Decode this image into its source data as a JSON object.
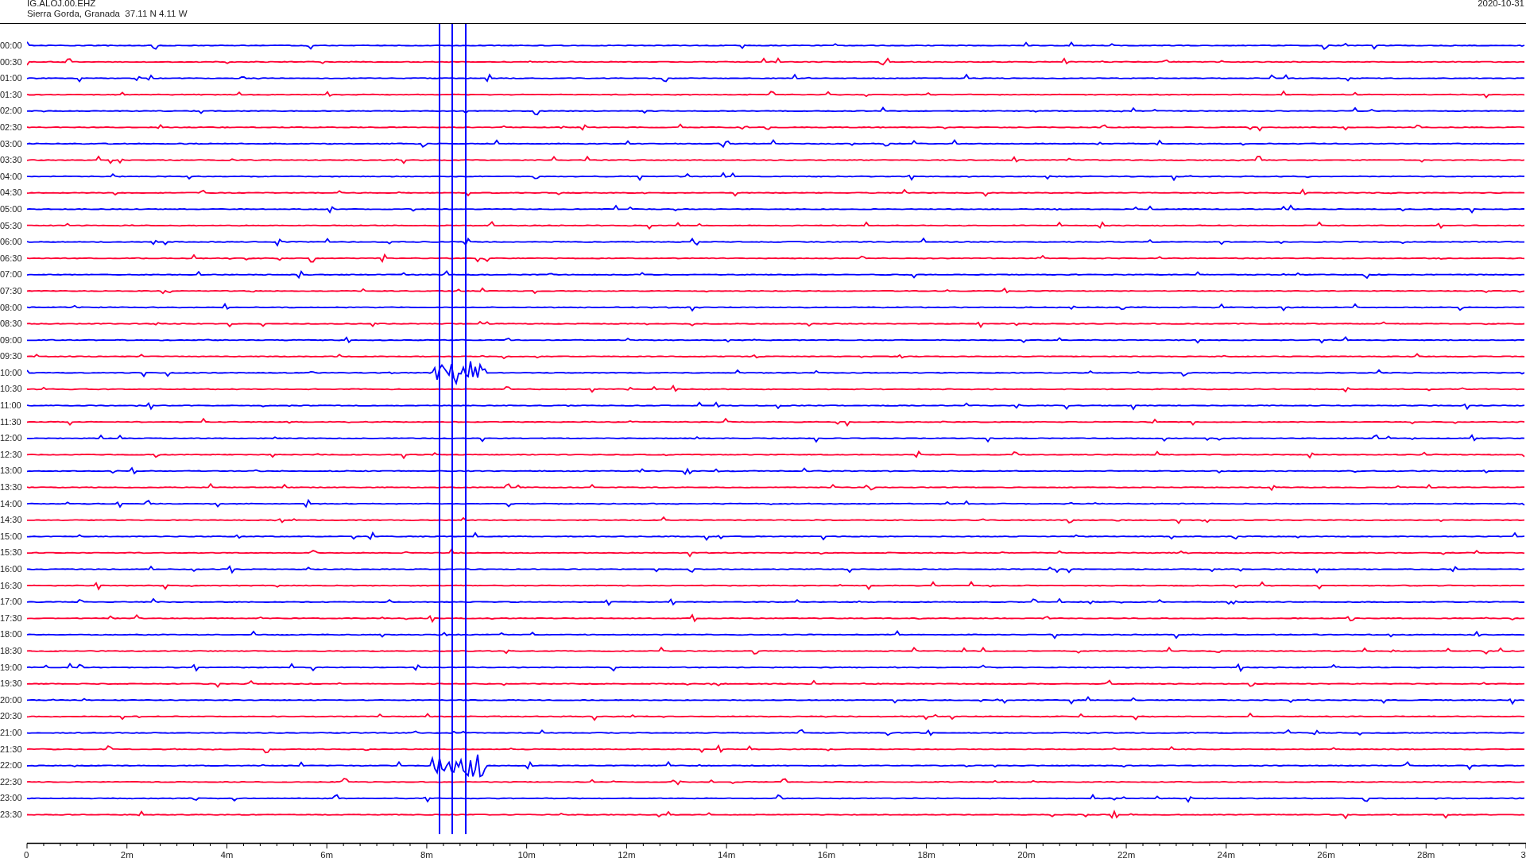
{
  "header": {
    "station": "IG.ALOJ.00.EHZ",
    "location": "Sierra Gorda, Granada  37.11 N 4.11 W",
    "date": "2020-10-31"
  },
  "rows": [
    {
      "time": "00:00",
      "color": "#0000ff"
    },
    {
      "time": "00:30",
      "color": "#ff0033"
    },
    {
      "time": "01:00",
      "color": "#0000ff"
    },
    {
      "time": "01:30",
      "color": "#ff0033"
    },
    {
      "time": "02:00",
      "color": "#0000ff"
    },
    {
      "time": "02:30",
      "color": "#ff0033"
    },
    {
      "time": "03:00",
      "color": "#0000ff"
    },
    {
      "time": "03:30",
      "color": "#ff0033"
    },
    {
      "time": "04:00",
      "color": "#0000ff"
    },
    {
      "time": "04:30",
      "color": "#ff0033"
    },
    {
      "time": "05:00",
      "color": "#0000ff"
    },
    {
      "time": "05:30",
      "color": "#ff0033"
    },
    {
      "time": "06:00",
      "color": "#0000ff"
    },
    {
      "time": "06:30",
      "color": "#ff0033"
    },
    {
      "time": "07:00",
      "color": "#0000ff"
    },
    {
      "time": "07:30",
      "color": "#ff0033"
    },
    {
      "time": "08:00",
      "color": "#0000ff"
    },
    {
      "time": "08:30",
      "color": "#ff0033"
    },
    {
      "time": "09:00",
      "color": "#0000ff"
    },
    {
      "time": "09:30",
      "color": "#ff0033"
    },
    {
      "time": "10:00",
      "color": "#0000ff"
    },
    {
      "time": "10:30",
      "color": "#ff0033"
    },
    {
      "time": "11:00",
      "color": "#0000ff"
    },
    {
      "time": "11:30",
      "color": "#ff0033"
    },
    {
      "time": "12:00",
      "color": "#0000ff"
    },
    {
      "time": "12:30",
      "color": "#ff0033"
    },
    {
      "time": "13:00",
      "color": "#0000ff"
    },
    {
      "time": "13:30",
      "color": "#ff0033"
    },
    {
      "time": "14:00",
      "color": "#0000ff"
    },
    {
      "time": "14:30",
      "color": "#ff0033"
    },
    {
      "time": "15:00",
      "color": "#0000ff"
    },
    {
      "time": "15:30",
      "color": "#ff0033"
    },
    {
      "time": "16:00",
      "color": "#0000ff"
    },
    {
      "time": "16:30",
      "color": "#ff0033"
    },
    {
      "time": "17:00",
      "color": "#0000ff"
    },
    {
      "time": "17:30",
      "color": "#ff0033"
    },
    {
      "time": "18:00",
      "color": "#0000ff"
    },
    {
      "time": "18:30",
      "color": "#ff0033"
    },
    {
      "time": "19:00",
      "color": "#0000ff"
    },
    {
      "time": "19:30",
      "color": "#ff0033"
    },
    {
      "time": "20:00",
      "color": "#0000ff"
    },
    {
      "time": "20:30",
      "color": "#ff0033"
    },
    {
      "time": "21:00",
      "color": "#0000ff"
    },
    {
      "time": "21:30",
      "color": "#ff0033"
    },
    {
      "time": "22:00",
      "color": "#0000ff"
    },
    {
      "time": "22:30",
      "color": "#ff0033"
    },
    {
      "time": "23:00",
      "color": "#0000ff"
    },
    {
      "time": "23:30",
      "color": "#ff0033"
    }
  ],
  "x_axis": {
    "ticks": [
      "0",
      "2m",
      "4m",
      "6m",
      "8m",
      "10m",
      "12m",
      "14m",
      "16m",
      "18m",
      "20m",
      "22m",
      "24m",
      "26m",
      "28m",
      "3"
    ]
  }
}
